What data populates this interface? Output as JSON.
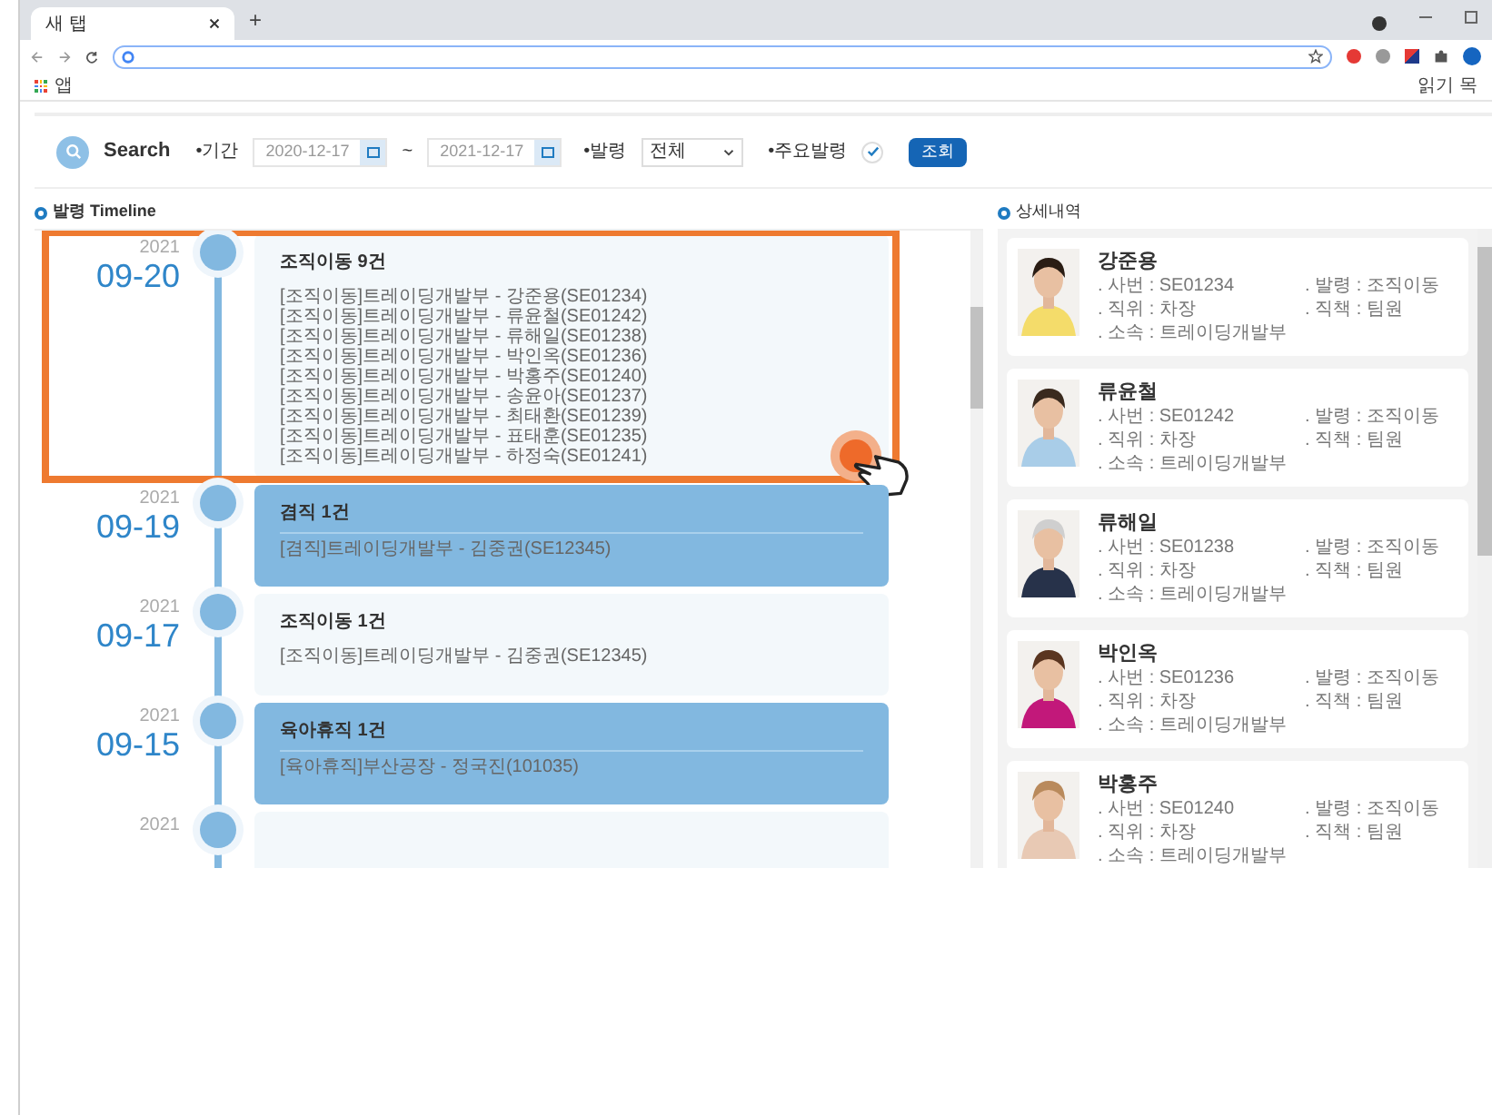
{
  "browser": {
    "tab_title": "새 탭",
    "new_tab": "+",
    "bookmark": "앱",
    "reading_list": "읽기 목"
  },
  "search": {
    "title": "Search",
    "period_label": "•기간",
    "date_from": "2020-12-17",
    "separator": "~",
    "date_to": "2021-12-17",
    "type_label": "•발령",
    "type_value": "전체",
    "major_label": "•주요발령",
    "major_checked": true,
    "button": "조회"
  },
  "timeline": {
    "title": "발령 Timeline",
    "entries": [
      {
        "year": "2021",
        "date": "09-20",
        "title": "조직이동 9건",
        "highlighted": false,
        "focused": true,
        "lines": [
          "[조직이동]트레이딩개발부 - 강준용(SE01234)",
          "[조직이동]트레이딩개발부 - 류윤철(SE01242)",
          "[조직이동]트레이딩개발부 - 류해일(SE01238)",
          "[조직이동]트레이딩개발부 - 박인옥(SE01236)",
          "[조직이동]트레이딩개발부 - 박홍주(SE01240)",
          "[조직이동]트레이딩개발부 - 송윤아(SE01237)",
          "[조직이동]트레이딩개발부 - 최태환(SE01239)",
          "[조직이동]트레이딩개발부 - 표태훈(SE01235)",
          "[조직이동]트레이딩개발부 - 하정숙(SE01241)"
        ]
      },
      {
        "year": "2021",
        "date": "09-19",
        "title": "겸직 1건",
        "highlighted": true,
        "focused": false,
        "lines": [
          "[겸직]트레이딩개발부 - 김중권(SE12345)"
        ]
      },
      {
        "year": "2021",
        "date": "09-17",
        "title": "조직이동 1건",
        "highlighted": false,
        "focused": false,
        "lines": [
          "[조직이동]트레이딩개발부 - 김중권(SE12345)"
        ]
      },
      {
        "year": "2021",
        "date": "09-15",
        "title": "육아휴직 1건",
        "highlighted": true,
        "focused": false,
        "lines": [
          "[육아휴직]부산공장 - 정국진(101035)"
        ]
      },
      {
        "year": "2021",
        "highlighted": false,
        "focused": false
      }
    ]
  },
  "details": {
    "title": "상세내역",
    "people": [
      {
        "name": "강준용",
        "fields": [
          ". 사번 : SE01234",
          ". 발령 : 조직이동",
          ". 직위 : 차장",
          ". 직책 : 팀원",
          ". 소속 : 트레이딩개발부"
        ]
      },
      {
        "name": "류윤철",
        "fields": [
          ". 사번 : SE01242",
          ". 발령 : 조직이동",
          ". 직위 : 차장",
          ". 직책 : 팀원",
          ". 소속 : 트레이딩개발부"
        ]
      },
      {
        "name": "류해일",
        "fields": [
          ". 사번 : SE01238",
          ". 발령 : 조직이동",
          ". 직위 : 차장",
          ". 직책 : 팀원",
          ". 소속 : 트레이딩개발부"
        ]
      },
      {
        "name": "박인옥",
        "fields": [
          ". 사번 : SE01236",
          ". 발령 : 조직이동",
          ". 직위 : 차장",
          ". 직책 : 팀원",
          ". 소속 : 트레이딩개발부"
        ]
      },
      {
        "name": "박홍주",
        "fields": [
          ". 사번 : SE01240",
          ". 발령 : 조직이동",
          ". 직위 : 차장",
          ". 직책 : 팀원",
          ". 소속 : 트레이딩개발부"
        ]
      }
    ]
  }
}
